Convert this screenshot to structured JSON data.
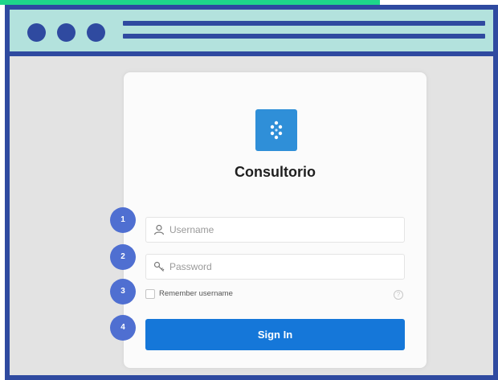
{
  "app": {
    "title": "Consultorio",
    "logo_icon": "dots-cluster-icon",
    "accent_color": "#1577d9"
  },
  "form": {
    "username": {
      "placeholder": "Username",
      "value": "",
      "icon": "user-icon"
    },
    "password": {
      "placeholder": "Password",
      "value": "",
      "icon": "key-icon"
    },
    "remember_label": "Remember username",
    "remember_checked": false,
    "help_icon": "help-circle-icon",
    "sign_in_label": "Sign In"
  },
  "badges": [
    "1",
    "2",
    "3",
    "4"
  ]
}
